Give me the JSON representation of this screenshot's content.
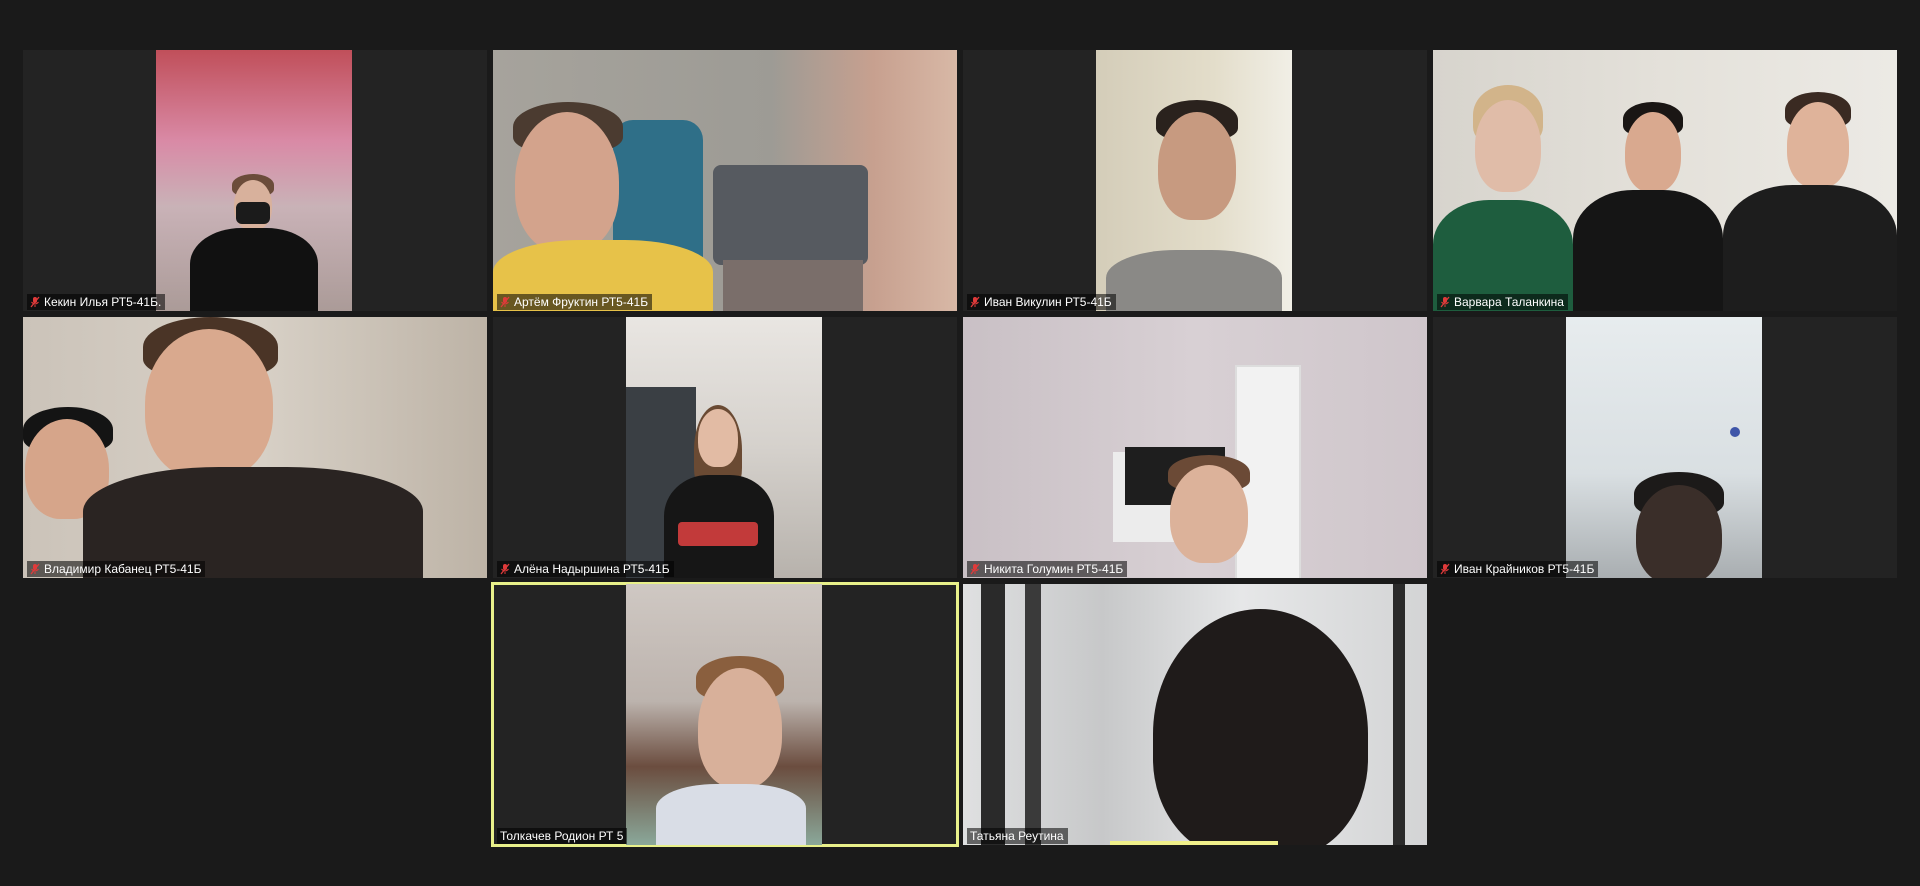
{
  "meeting": {
    "participants": [
      {
        "id": "p1",
        "name": "Кекин Илья РТ5-41Б.",
        "muted": true
      },
      {
        "id": "p2",
        "name": "Артём Фруктин РТ5-41Б",
        "muted": true
      },
      {
        "id": "p3",
        "name": "Иван Викулин РТ5-41Б",
        "muted": true
      },
      {
        "id": "p4",
        "name": "Варвара Таланкина",
        "muted": true
      },
      {
        "id": "p5",
        "name": "Владимир Кабанец РТ5-41Б",
        "muted": true
      },
      {
        "id": "p6",
        "name": "Алёна Надыршина РТ5-41Б",
        "muted": true
      },
      {
        "id": "p7",
        "name": "Никита Голумин РТ5-41Б",
        "muted": true
      },
      {
        "id": "p8",
        "name": "Иван Крайников РТ5-41Б",
        "muted": true
      },
      {
        "id": "p9",
        "name": "Толкачев Родион РТ 5",
        "muted": false,
        "active_speaker": true
      },
      {
        "id": "p10",
        "name": "Татьяна Реутина",
        "muted": false
      }
    ]
  },
  "icons": {
    "mute": "mic-muted-icon"
  },
  "colors": {
    "background": "#1a1a1a",
    "tile": "#232323",
    "active_border": "#e8f08a",
    "mute_icon": "#e03a3a"
  }
}
